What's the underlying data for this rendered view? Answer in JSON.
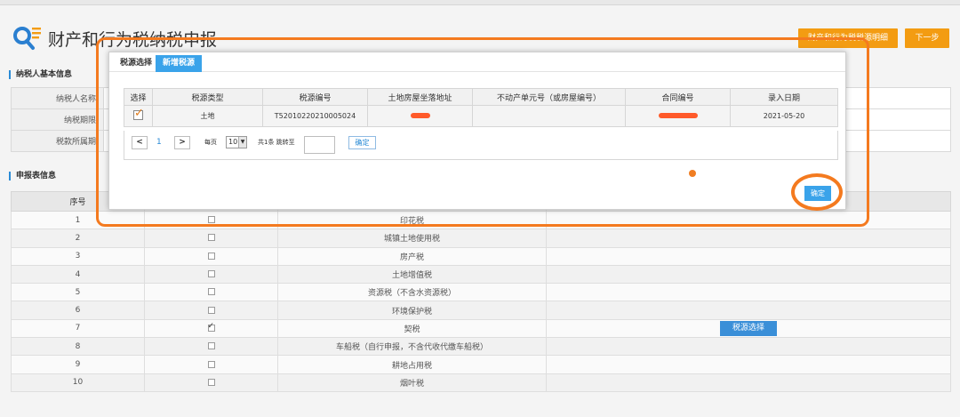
{
  "header": {
    "title": "财产和行为税纳税申报",
    "detail_button": "财产和行为税税源明细",
    "next_button": "下一步"
  },
  "sections": {
    "taxpayer_info": "纳税人基本信息",
    "declaration_info": "申报表信息"
  },
  "taxpayer_info": {
    "labels": [
      "纳税人名称",
      "纳税期限",
      "税款所属期"
    ]
  },
  "declaration_table": {
    "headers": [
      "序号",
      "",
      "",
      ""
    ],
    "rows": [
      {
        "seq": "1",
        "checked": false,
        "name": "印花税",
        "action": ""
      },
      {
        "seq": "2",
        "checked": false,
        "name": "城镇土地使用税",
        "action": ""
      },
      {
        "seq": "3",
        "checked": false,
        "name": "房产税",
        "action": ""
      },
      {
        "seq": "4",
        "checked": false,
        "name": "土地增值税",
        "action": ""
      },
      {
        "seq": "5",
        "checked": false,
        "name": "资源税（不含水资源税）",
        "action": ""
      },
      {
        "seq": "6",
        "checked": false,
        "name": "环境保护税",
        "action": ""
      },
      {
        "seq": "7",
        "checked": true,
        "name": "契税",
        "action": "税源选择"
      },
      {
        "seq": "8",
        "checked": false,
        "name": "车船税（自行申报，不含代收代缴车船税）",
        "action": ""
      },
      {
        "seq": "9",
        "checked": false,
        "name": "耕地占用税",
        "action": ""
      },
      {
        "seq": "10",
        "checked": false,
        "name": "烟叶税",
        "action": ""
      }
    ]
  },
  "modal": {
    "tabs": [
      "税源选择",
      "新增税源"
    ],
    "table_headers": [
      "选择",
      "税源类型",
      "税源编号",
      "土地房屋坐落地址",
      "不动产单元号（或房屋编号）",
      "合同编号",
      "录入日期"
    ],
    "row": {
      "type": "土地",
      "source_no": "T5201022021000502­4",
      "address": "",
      "unit_no": "",
      "contract_no": "",
      "date": "2021-05-20"
    },
    "pager": {
      "prev": "<",
      "page": "1",
      "next": ">",
      "per_page_label": "每页",
      "per_page_value": "10",
      "total_text": "共1条 跳转至",
      "ok": "确定"
    },
    "confirm_button": "确定"
  },
  "colors": {
    "accent_orange": "#f39c12",
    "accent_blue": "#3aa3ea",
    "annotation": "#f47a1f"
  }
}
